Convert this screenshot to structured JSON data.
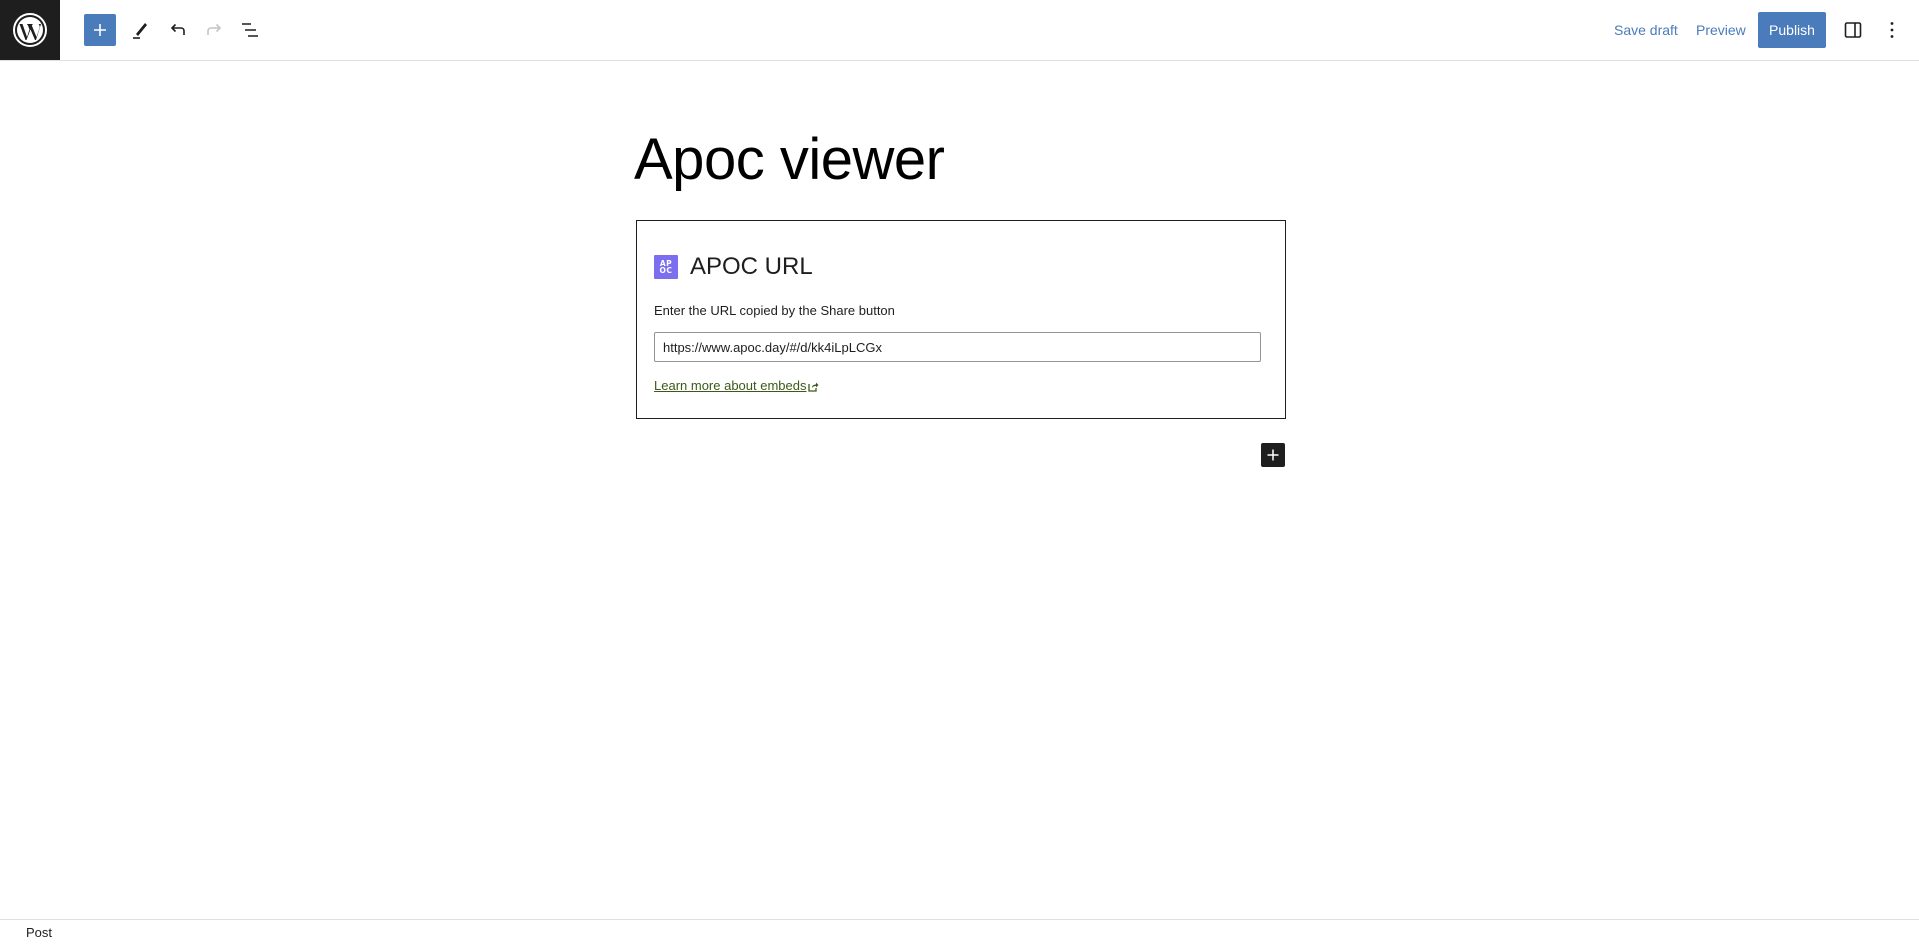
{
  "header": {
    "logo": "wordpress-logo",
    "tools": [
      {
        "name": "block-inserter",
        "icon": "plus-icon"
      },
      {
        "name": "tools",
        "icon": "pencil-icon"
      },
      {
        "name": "undo",
        "icon": "undo-icon"
      },
      {
        "name": "redo",
        "icon": "redo-icon",
        "disabled": true
      },
      {
        "name": "document-overview",
        "icon": "list-view-icon"
      }
    ],
    "save_draft_label": "Save draft",
    "preview_label": "Preview",
    "publish_label": "Publish",
    "settings_icon": "sidebar-icon",
    "options_icon": "more-vertical-icon"
  },
  "post": {
    "title": "Apoc viewer"
  },
  "embed": {
    "icon_text_top": "AP",
    "icon_text_bottom": "OC",
    "title": "APOC URL",
    "instructions": "Enter the URL copied by the Share button",
    "url_value": "https://www.apoc.day/#/d/kk4iLpLCGx",
    "learn_more_label": "Learn more about embeds"
  },
  "footer": {
    "breadcrumb": "Post"
  },
  "colors": {
    "accent": "#4a7bba",
    "apoc_icon": "#7b6ff0",
    "link": "#3b5a18",
    "dark": "#1e1e1e"
  }
}
